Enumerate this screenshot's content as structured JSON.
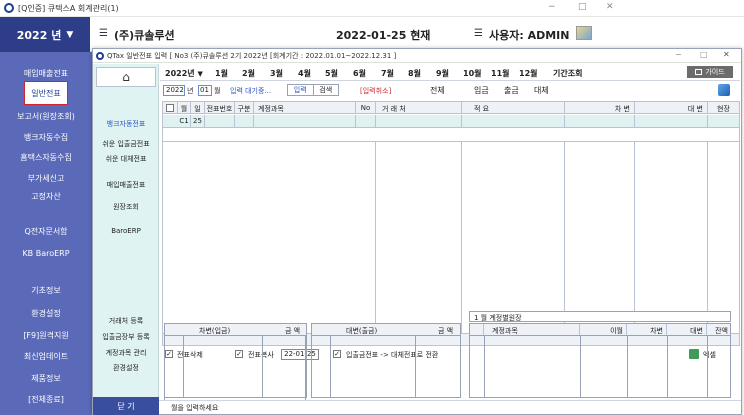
{
  "main_window": {
    "title": "[Q인증] 큐텍스A  회계관리(1)",
    "year": "2022 년",
    "company": "(주)큐솔루션",
    "date": "2022-01-25 현재",
    "user": "사용자: ADMIN",
    "controls": [
      "−",
      "□",
      "✕"
    ]
  },
  "left_menu": [
    "매입매출전표",
    "일반전표",
    "보고서(원장조회)",
    "뱅크자동수집",
    "홈택스자동수집",
    "부가세신고",
    "고정자산",
    "Q전자문서함",
    "KB BaroERP",
    "기초정보",
    "환경설정",
    "[F9]원격지원",
    "최신업데이트",
    "제품정보",
    "[전체종료]"
  ],
  "child_window": {
    "title": "QTax 일반전표 입력 [ No3 (주)큐솔루션 2기 2022년 [회계기간 : 2022.01.01~2022.12.31 ]",
    "controls": [
      "−",
      "□",
      "✕"
    ]
  },
  "side_panel": [
    "뱅크자동전표",
    "쉬운 입출금전표",
    "쉬운 대체전표",
    "매입매출전표",
    "원장조회",
    "BaroERP"
  ],
  "side_bottom": [
    "거래처 등록",
    "입출금장부 등록",
    "계정과목 관리",
    "환경설정"
  ],
  "close_label": "닫 기",
  "toolbar": {
    "year": "2022년",
    "months": [
      "1월",
      "2월",
      "3월",
      "4월",
      "5월",
      "6월",
      "7월",
      "8월",
      "9월",
      "10월",
      "11월",
      "12월"
    ],
    "period": "기간조회",
    "guide": "가이드"
  },
  "entry": {
    "year": "2022",
    "year_suffix": "년",
    "month": "01",
    "month_suffix": "월",
    "status": "입력 대기중...",
    "tab_input": "입력",
    "tab_search": "검색",
    "cancel": "[입력취소]",
    "filters": [
      "전체",
      "입금",
      "출금",
      "대체"
    ]
  },
  "grid": {
    "headers": [
      "월",
      "일",
      "전표번호",
      "구분",
      "계정과목",
      "No",
      "거 래 처",
      "적   요",
      "차  변",
      "대  변",
      "현장"
    ],
    "row": {
      "month": "C1",
      "day": "25"
    }
  },
  "options": {
    "delete": "전표삭제",
    "copy": "전표복사",
    "copy_date": "22-01-25",
    "convert": "입출금전표 -> 대체전표로 전환",
    "excel": "엑셀"
  },
  "bottom": {
    "debit_header": "차변(입금)",
    "debit_amount": "금  액",
    "credit_header": "대변(출금)",
    "credit_amount": "금  액",
    "ledger_title": "1 월  계정별원장",
    "ledger_headers": [
      "계정과목",
      "이월",
      "차변",
      "대변",
      "잔액"
    ]
  },
  "status_text": "월을 입력하세요",
  "colors": {
    "sidebar": "#5a6ab8",
    "accent": "#2b56c6",
    "highlight_row": "#dff1f1",
    "selected_red": "#d4242b"
  }
}
